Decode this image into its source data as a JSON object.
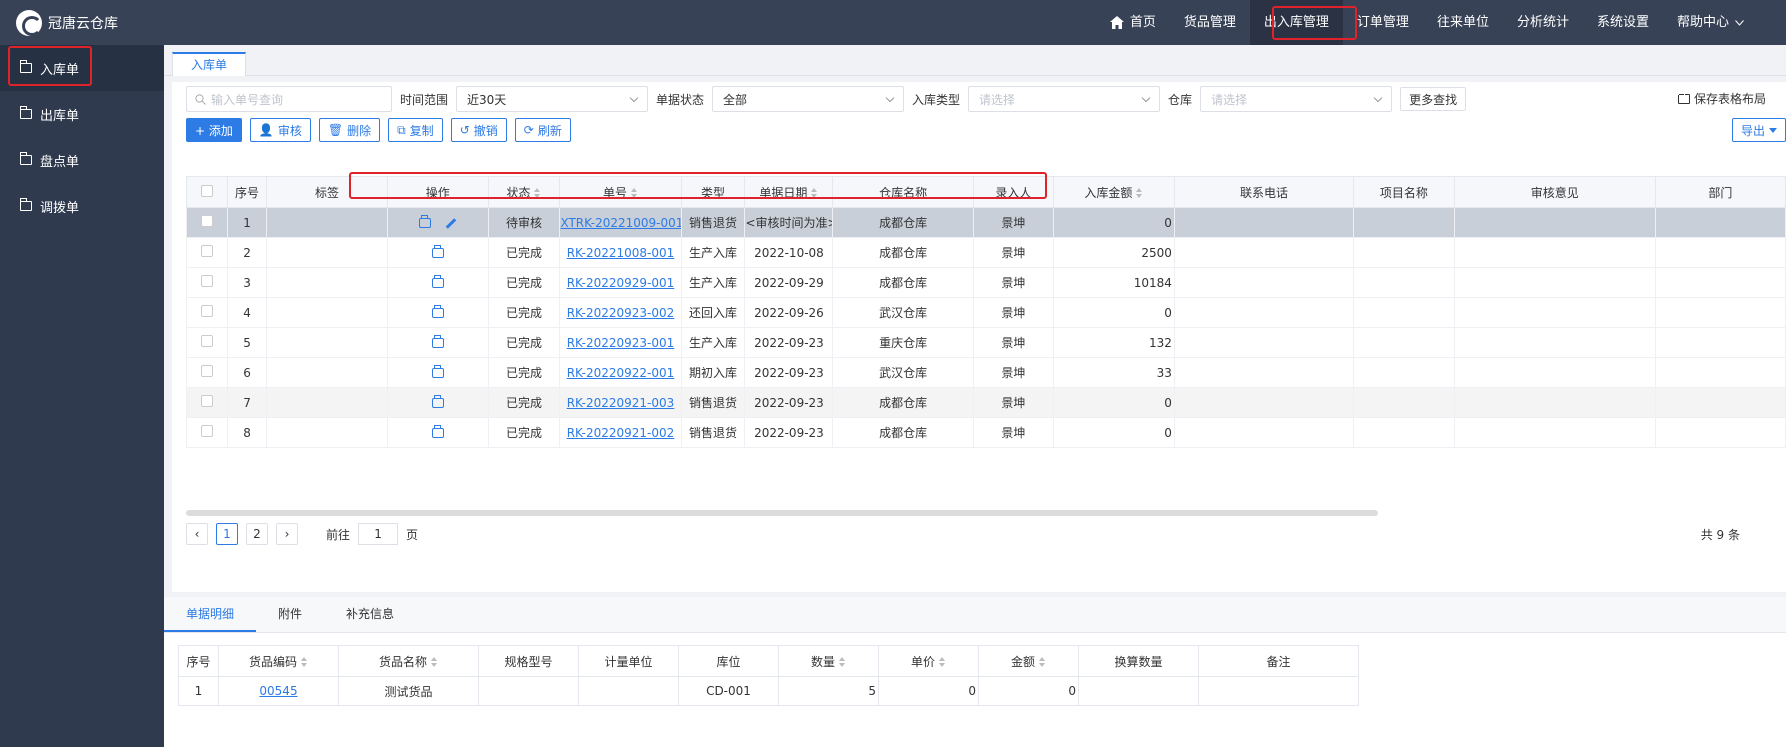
{
  "app": {
    "title": "冠唐云仓库"
  },
  "topnav": {
    "home": "首页",
    "items": [
      "货品管理",
      "出入库管理",
      "订单管理",
      "往来单位",
      "分析统计",
      "系统设置",
      "帮助中心"
    ]
  },
  "sidebar": {
    "items": [
      {
        "label": "入库单"
      },
      {
        "label": "出库单"
      },
      {
        "label": "盘点单"
      },
      {
        "label": "调拨单"
      }
    ]
  },
  "tabs": {
    "active": "入库单"
  },
  "filters": {
    "search_placeholder": "输入单号查询",
    "range_label": "时间范围",
    "range_value": "近30天",
    "status_label": "单据状态",
    "status_value": "全部",
    "type_label": "入库类型",
    "type_placeholder": "请选择",
    "warehouse_label": "仓库",
    "warehouse_placeholder": "请选择",
    "more": "更多查找",
    "save_layout": "保存表格布局"
  },
  "actions": {
    "add": "+ 添加",
    "audit": "审核",
    "delete": "删除",
    "copy": "复制",
    "revoke": "撤销",
    "refresh": "刷新",
    "export": "导出"
  },
  "table": {
    "headers": [
      "序号",
      "标签",
      "操作",
      "状态",
      "单号",
      "类型",
      "单据日期",
      "仓库名称",
      "录入人",
      "入库金额",
      "联系电话",
      "项目名称",
      "审核意见",
      "部门"
    ],
    "rows": [
      {
        "no": "1",
        "status": "待审核",
        "code": "XTRK-20221009-001",
        "type": "销售退货",
        "date": "<审核时间为准>",
        "warehouse": "成都仓库",
        "user": "景坤",
        "amount": "0"
      },
      {
        "no": "2",
        "status": "已完成",
        "code": "RK-20221008-001",
        "type": "生产入库",
        "date": "2022-10-08",
        "warehouse": "成都仓库",
        "user": "景坤",
        "amount": "2500"
      },
      {
        "no": "3",
        "status": "已完成",
        "code": "RK-20220929-001",
        "type": "生产入库",
        "date": "2022-09-29",
        "warehouse": "成都仓库",
        "user": "景坤",
        "amount": "10184"
      },
      {
        "no": "4",
        "status": "已完成",
        "code": "RK-20220923-002",
        "type": "还回入库",
        "date": "2022-09-26",
        "warehouse": "武汉仓库",
        "user": "景坤",
        "amount": "0"
      },
      {
        "no": "5",
        "status": "已完成",
        "code": "RK-20220923-001",
        "type": "生产入库",
        "date": "2022-09-23",
        "warehouse": "重庆仓库",
        "user": "景坤",
        "amount": "132"
      },
      {
        "no": "6",
        "status": "已完成",
        "code": "RK-20220922-001",
        "type": "期初入库",
        "date": "2022-09-23",
        "warehouse": "武汉仓库",
        "user": "景坤",
        "amount": "33"
      },
      {
        "no": "7",
        "status": "已完成",
        "code": "RK-20220921-003",
        "type": "销售退货",
        "date": "2022-09-23",
        "warehouse": "成都仓库",
        "user": "景坤",
        "amount": "0"
      },
      {
        "no": "8",
        "status": "已完成",
        "code": "RK-20220921-002",
        "type": "销售退货",
        "date": "2022-09-23",
        "warehouse": "成都仓库",
        "user": "景坤",
        "amount": "0"
      }
    ]
  },
  "pager": {
    "pages": [
      "1",
      "2"
    ],
    "goto_prefix": "前往",
    "goto_value": "1",
    "goto_suffix": "页",
    "total": "共 9 条"
  },
  "detail": {
    "tabs": [
      "单据明细",
      "附件",
      "补充信息"
    ],
    "headers": [
      "序号",
      "货品编码",
      "货品名称",
      "规格型号",
      "计量单位",
      "库位",
      "数量",
      "单价",
      "金额",
      "换算数量",
      "备注"
    ],
    "rows": [
      {
        "no": "1",
        "code": "00545",
        "name": "测试货品",
        "spec": "",
        "unit": "",
        "location": "CD-001",
        "qty": "5",
        "price": "0",
        "amount": "0",
        "conv": "",
        "note": ""
      }
    ]
  }
}
